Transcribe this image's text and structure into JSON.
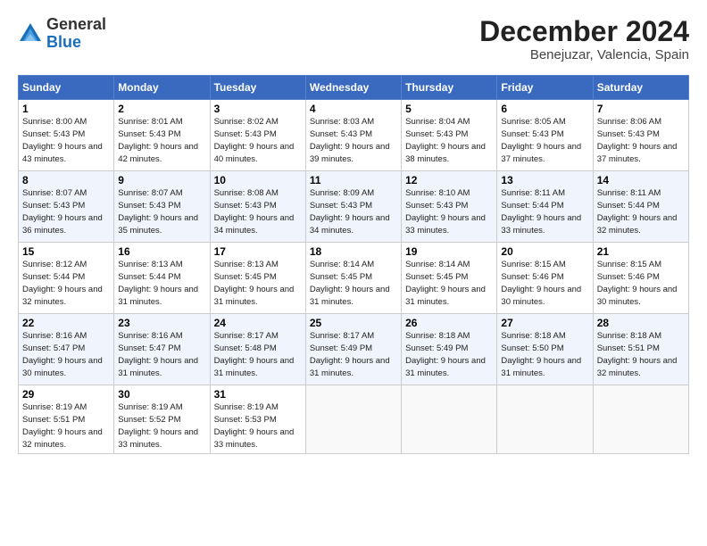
{
  "logo": {
    "general": "General",
    "blue": "Blue"
  },
  "title": "December 2024",
  "location": "Benejuzar, Valencia, Spain",
  "days_header": [
    "Sunday",
    "Monday",
    "Tuesday",
    "Wednesday",
    "Thursday",
    "Friday",
    "Saturday"
  ],
  "weeks": [
    [
      {
        "num": "1",
        "sunrise": "8:00 AM",
        "sunset": "5:43 PM",
        "daylight": "9 hours and 43 minutes."
      },
      {
        "num": "2",
        "sunrise": "8:01 AM",
        "sunset": "5:43 PM",
        "daylight": "9 hours and 42 minutes."
      },
      {
        "num": "3",
        "sunrise": "8:02 AM",
        "sunset": "5:43 PM",
        "daylight": "9 hours and 40 minutes."
      },
      {
        "num": "4",
        "sunrise": "8:03 AM",
        "sunset": "5:43 PM",
        "daylight": "9 hours and 39 minutes."
      },
      {
        "num": "5",
        "sunrise": "8:04 AM",
        "sunset": "5:43 PM",
        "daylight": "9 hours and 38 minutes."
      },
      {
        "num": "6",
        "sunrise": "8:05 AM",
        "sunset": "5:43 PM",
        "daylight": "9 hours and 37 minutes."
      },
      {
        "num": "7",
        "sunrise": "8:06 AM",
        "sunset": "5:43 PM",
        "daylight": "9 hours and 37 minutes."
      }
    ],
    [
      {
        "num": "8",
        "sunrise": "8:07 AM",
        "sunset": "5:43 PM",
        "daylight": "9 hours and 36 minutes."
      },
      {
        "num": "9",
        "sunrise": "8:07 AM",
        "sunset": "5:43 PM",
        "daylight": "9 hours and 35 minutes."
      },
      {
        "num": "10",
        "sunrise": "8:08 AM",
        "sunset": "5:43 PM",
        "daylight": "9 hours and 34 minutes."
      },
      {
        "num": "11",
        "sunrise": "8:09 AM",
        "sunset": "5:43 PM",
        "daylight": "9 hours and 34 minutes."
      },
      {
        "num": "12",
        "sunrise": "8:10 AM",
        "sunset": "5:43 PM",
        "daylight": "9 hours and 33 minutes."
      },
      {
        "num": "13",
        "sunrise": "8:11 AM",
        "sunset": "5:44 PM",
        "daylight": "9 hours and 33 minutes."
      },
      {
        "num": "14",
        "sunrise": "8:11 AM",
        "sunset": "5:44 PM",
        "daylight": "9 hours and 32 minutes."
      }
    ],
    [
      {
        "num": "15",
        "sunrise": "8:12 AM",
        "sunset": "5:44 PM",
        "daylight": "9 hours and 32 minutes."
      },
      {
        "num": "16",
        "sunrise": "8:13 AM",
        "sunset": "5:44 PM",
        "daylight": "9 hours and 31 minutes."
      },
      {
        "num": "17",
        "sunrise": "8:13 AM",
        "sunset": "5:45 PM",
        "daylight": "9 hours and 31 minutes."
      },
      {
        "num": "18",
        "sunrise": "8:14 AM",
        "sunset": "5:45 PM",
        "daylight": "9 hours and 31 minutes."
      },
      {
        "num": "19",
        "sunrise": "8:14 AM",
        "sunset": "5:45 PM",
        "daylight": "9 hours and 31 minutes."
      },
      {
        "num": "20",
        "sunrise": "8:15 AM",
        "sunset": "5:46 PM",
        "daylight": "9 hours and 30 minutes."
      },
      {
        "num": "21",
        "sunrise": "8:15 AM",
        "sunset": "5:46 PM",
        "daylight": "9 hours and 30 minutes."
      }
    ],
    [
      {
        "num": "22",
        "sunrise": "8:16 AM",
        "sunset": "5:47 PM",
        "daylight": "9 hours and 30 minutes."
      },
      {
        "num": "23",
        "sunrise": "8:16 AM",
        "sunset": "5:47 PM",
        "daylight": "9 hours and 31 minutes."
      },
      {
        "num": "24",
        "sunrise": "8:17 AM",
        "sunset": "5:48 PM",
        "daylight": "9 hours and 31 minutes."
      },
      {
        "num": "25",
        "sunrise": "8:17 AM",
        "sunset": "5:49 PM",
        "daylight": "9 hours and 31 minutes."
      },
      {
        "num": "26",
        "sunrise": "8:18 AM",
        "sunset": "5:49 PM",
        "daylight": "9 hours and 31 minutes."
      },
      {
        "num": "27",
        "sunrise": "8:18 AM",
        "sunset": "5:50 PM",
        "daylight": "9 hours and 31 minutes."
      },
      {
        "num": "28",
        "sunrise": "8:18 AM",
        "sunset": "5:51 PM",
        "daylight": "9 hours and 32 minutes."
      }
    ],
    [
      {
        "num": "29",
        "sunrise": "8:19 AM",
        "sunset": "5:51 PM",
        "daylight": "9 hours and 32 minutes."
      },
      {
        "num": "30",
        "sunrise": "8:19 AM",
        "sunset": "5:52 PM",
        "daylight": "9 hours and 33 minutes."
      },
      {
        "num": "31",
        "sunrise": "8:19 AM",
        "sunset": "5:53 PM",
        "daylight": "9 hours and 33 minutes."
      },
      null,
      null,
      null,
      null
    ]
  ]
}
